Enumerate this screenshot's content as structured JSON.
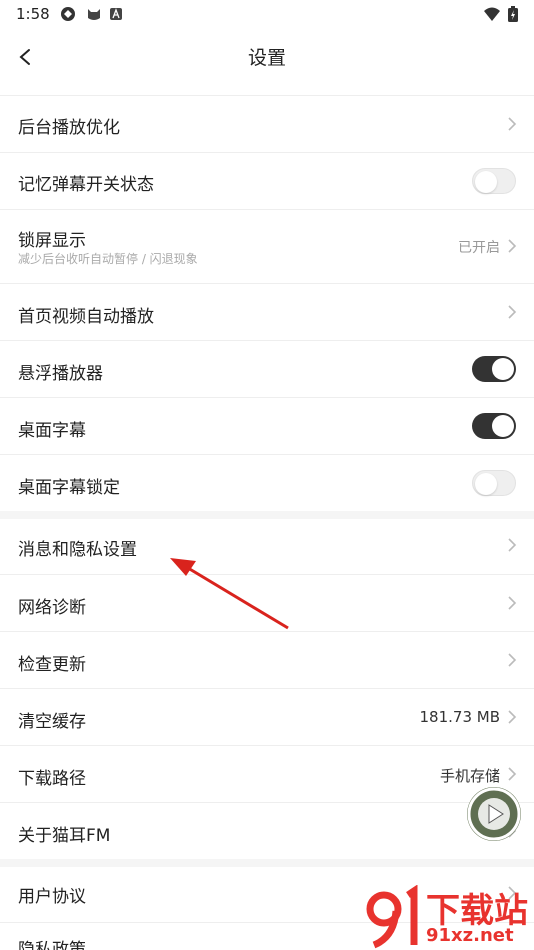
{
  "status_bar": {
    "time": "1:58",
    "icons": [
      "sync-icon",
      "cat-icon",
      "a-badge-icon",
      "wifi-icon",
      "battery-icon"
    ]
  },
  "header": {
    "title": "设置",
    "back_icon": "back-arrow-icon"
  },
  "rows": [
    {
      "label": "后台播放优化",
      "control": "chevron"
    },
    {
      "label": "记忆弹幕开关状态",
      "control": "toggle",
      "on": false
    },
    {
      "label": "锁屏显示",
      "sublabel": "减少后台收听自动暂停 / 闪退现象",
      "value": "已开启",
      "control": "chevron"
    },
    {
      "label": "首页视频自动播放",
      "control": "chevron"
    },
    {
      "label": "悬浮播放器",
      "control": "toggle",
      "on": true
    },
    {
      "label": "桌面字幕",
      "control": "toggle",
      "on": true
    },
    {
      "label": "桌面字幕锁定",
      "control": "toggle",
      "on": false
    },
    {
      "label": "消息和隐私设置",
      "control": "chevron"
    },
    {
      "label": "网络诊断",
      "control": "chevron"
    },
    {
      "label": "检查更新",
      "control": "chevron"
    },
    {
      "label": "清空缓存",
      "value": "181.73 MB",
      "control": "chevron"
    },
    {
      "label": "下载路径",
      "value": "手机存储",
      "control": "chevron"
    },
    {
      "label": "关于猫耳FM",
      "control": "chevron"
    },
    {
      "label": "用户协议",
      "control": "chevron"
    },
    {
      "label": "隐私政策",
      "control": "chevron"
    }
  ],
  "watermark": {
    "brand": "下载站",
    "domain": "91xz.net"
  },
  "colors": {
    "toggle_on": "#333333",
    "toggle_off": "#efefef",
    "annotation_arrow": "#d9231d",
    "watermark": "#e8332e"
  }
}
